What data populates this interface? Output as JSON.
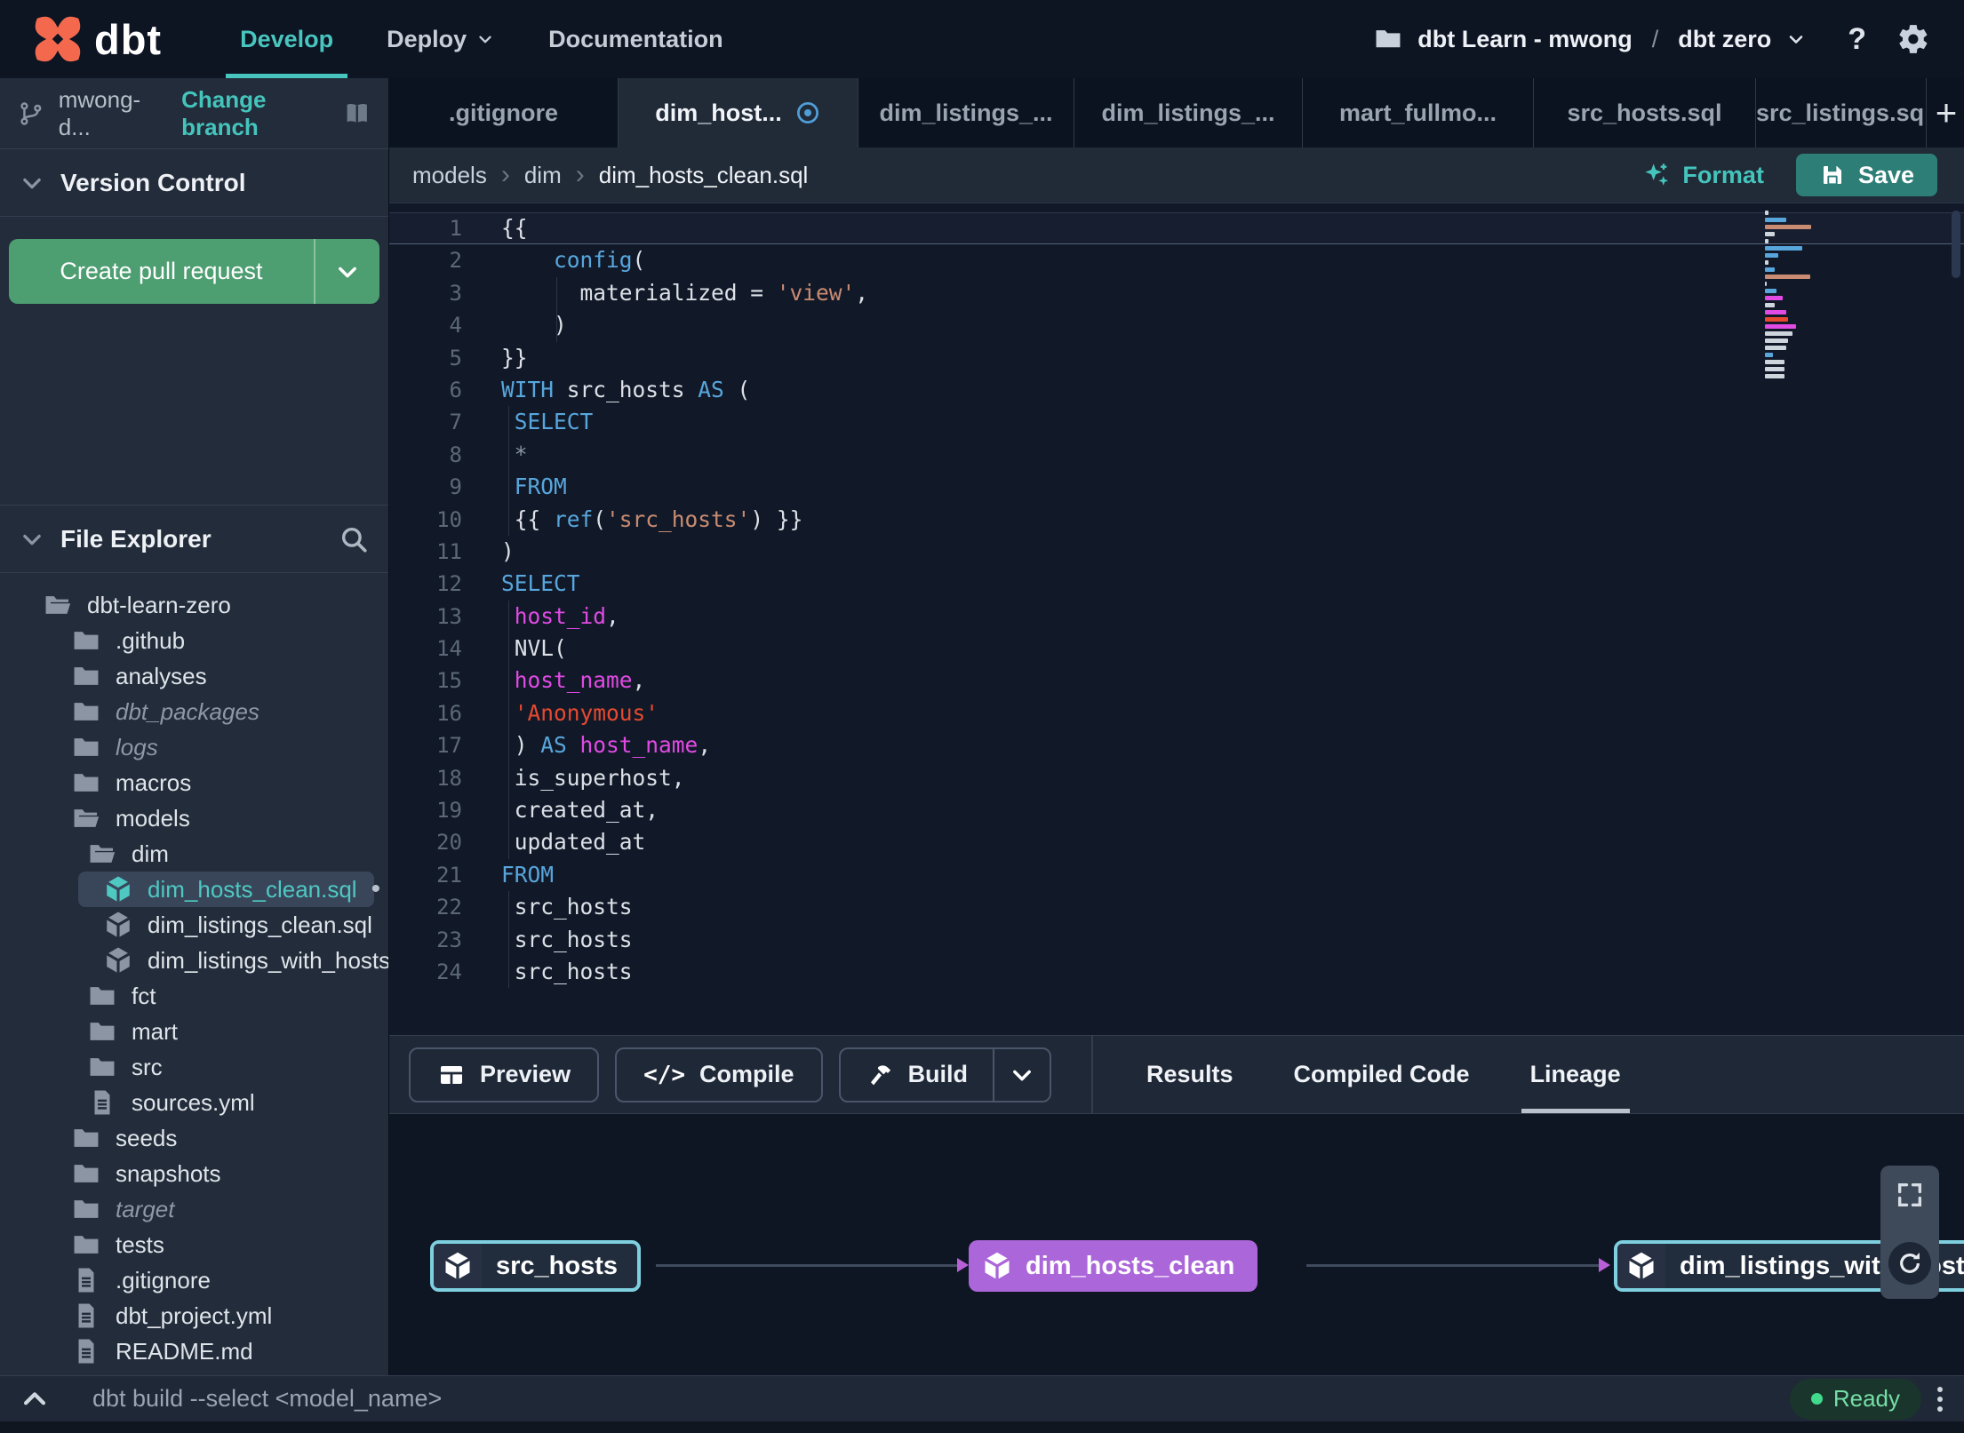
{
  "topnav": {
    "logo_text": "dbt",
    "nav": [
      {
        "label": "Develop",
        "active": true
      },
      {
        "label": "Deploy",
        "caret": true
      },
      {
        "label": "Documentation"
      }
    ],
    "project": {
      "name": "dbt Learn - mwong",
      "sep": "/",
      "env": "dbt zero"
    },
    "help_label": "?"
  },
  "sidebar": {
    "branch": {
      "name": "mwong-d...",
      "change_label": "Change branch"
    },
    "version_control": {
      "title": "Version Control",
      "create_pr_label": "Create pull request"
    },
    "file_explorer": {
      "title": "File Explorer",
      "tree": [
        {
          "label": "dbt-learn-zero",
          "type": "folder-open",
          "level": 0
        },
        {
          "label": ".github",
          "type": "folder",
          "level": 1
        },
        {
          "label": "analyses",
          "type": "folder",
          "level": 1
        },
        {
          "label": "dbt_packages",
          "type": "folder",
          "level": 1,
          "italic": true
        },
        {
          "label": "logs",
          "type": "folder",
          "level": 1,
          "italic": true
        },
        {
          "label": "macros",
          "type": "folder",
          "level": 1
        },
        {
          "label": "models",
          "type": "folder-open",
          "level": 1
        },
        {
          "label": "dim",
          "type": "folder-open",
          "level": 2
        },
        {
          "label": "dim_hosts_clean.sql",
          "type": "model",
          "level": 3,
          "selected": true,
          "modified": true
        },
        {
          "label": "dim_listings_clean.sql",
          "type": "model",
          "level": 3
        },
        {
          "label": "dim_listings_with_hosts...",
          "type": "model",
          "level": 3
        },
        {
          "label": "fct",
          "type": "folder",
          "level": 2
        },
        {
          "label": "mart",
          "type": "folder",
          "level": 2
        },
        {
          "label": "src",
          "type": "folder",
          "level": 2
        },
        {
          "label": "sources.yml",
          "type": "file",
          "level": 2
        },
        {
          "label": "seeds",
          "type": "folder",
          "level": 1
        },
        {
          "label": "snapshots",
          "type": "folder",
          "level": 1
        },
        {
          "label": "target",
          "type": "folder",
          "level": 1,
          "italic": true
        },
        {
          "label": "tests",
          "type": "folder",
          "level": 1
        },
        {
          "label": ".gitignore",
          "type": "file",
          "level": 1
        },
        {
          "label": "dbt_project.yml",
          "type": "file",
          "level": 1
        },
        {
          "label": "README.md",
          "type": "file",
          "level": 1
        }
      ]
    }
  },
  "tabs": [
    {
      "label": ".gitignore"
    },
    {
      "label": "dim_host...",
      "active": true,
      "modified": true
    },
    {
      "label": "dim_listings_..."
    },
    {
      "label": "dim_listings_..."
    },
    {
      "label": "mart_fullmo..."
    },
    {
      "label": "src_hosts.sql"
    },
    {
      "label": "src_listings.sql"
    }
  ],
  "new_tab_label": "+",
  "breadcrumb": {
    "items": [
      "models",
      "dim",
      "dim_hosts_clean.sql"
    ],
    "format_label": "Format",
    "save_label": "Save"
  },
  "editor": {
    "lines": [
      {
        "n": 1,
        "active": true,
        "segs": [
          {
            "t": "{{"
          }
        ]
      },
      {
        "n": 2,
        "segs": [
          {
            "t": "    "
          },
          {
            "t": "config",
            "c": "kw"
          },
          {
            "t": "("
          }
        ]
      },
      {
        "n": 3,
        "guides": [
          62
        ],
        "segs": [
          {
            "t": "      materialized = "
          },
          {
            "t": "'view'",
            "c": "str"
          },
          {
            "t": ","
          }
        ]
      },
      {
        "n": 4,
        "guides": [
          62
        ],
        "segs": [
          {
            "t": "    )"
          }
        ]
      },
      {
        "n": 5,
        "segs": [
          {
            "t": "}}"
          }
        ]
      },
      {
        "n": 6,
        "segs": [
          {
            "t": "WITH",
            "c": "kw"
          },
          {
            "t": " src_hosts "
          },
          {
            "t": "AS",
            "c": "kw"
          },
          {
            "t": " ("
          }
        ]
      },
      {
        "n": 7,
        "guides": [
          8
        ],
        "segs": [
          {
            "t": " "
          },
          {
            "t": "SELECT",
            "c": "kw"
          }
        ]
      },
      {
        "n": 8,
        "guides": [
          8
        ],
        "segs": [
          {
            "t": " "
          },
          {
            "t": "*",
            "c": "dim"
          }
        ]
      },
      {
        "n": 9,
        "guides": [
          8
        ],
        "segs": [
          {
            "t": " "
          },
          {
            "t": "FROM",
            "c": "kw"
          }
        ]
      },
      {
        "n": 10,
        "guides": [
          8
        ],
        "segs": [
          {
            "t": " {{ "
          },
          {
            "t": "ref",
            "c": "kw"
          },
          {
            "t": "("
          },
          {
            "t": "'src_hosts'",
            "c": "str"
          },
          {
            "t": ") }}"
          }
        ]
      },
      {
        "n": 11,
        "segs": [
          {
            "t": ")"
          }
        ]
      },
      {
        "n": 12,
        "segs": [
          {
            "t": "SELECT",
            "c": "kw"
          }
        ]
      },
      {
        "n": 13,
        "guides": [
          8
        ],
        "segs": [
          {
            "t": " "
          },
          {
            "t": "host_id",
            "c": "ident"
          },
          {
            "t": ","
          }
        ]
      },
      {
        "n": 14,
        "guides": [
          8
        ],
        "segs": [
          {
            "t": " NVL("
          }
        ]
      },
      {
        "n": 15,
        "guides": [
          8
        ],
        "segs": [
          {
            "t": " "
          },
          {
            "t": "host_name",
            "c": "ident"
          },
          {
            "t": ","
          }
        ]
      },
      {
        "n": 16,
        "guides": [
          8
        ],
        "segs": [
          {
            "t": " "
          },
          {
            "t": "'Anonymous'",
            "c": "red"
          }
        ]
      },
      {
        "n": 17,
        "guides": [
          8
        ],
        "segs": [
          {
            "t": " ) "
          },
          {
            "t": "AS",
            "c": "kw"
          },
          {
            "t": " "
          },
          {
            "t": "host_name",
            "c": "ident"
          },
          {
            "t": ","
          }
        ]
      },
      {
        "n": 18,
        "guides": [
          8
        ],
        "segs": [
          {
            "t": " is_superhost,"
          }
        ]
      },
      {
        "n": 19,
        "guides": [
          8
        ],
        "segs": [
          {
            "t": " created_at,"
          }
        ]
      },
      {
        "n": 20,
        "guides": [
          8
        ],
        "segs": [
          {
            "t": " updated_at"
          }
        ]
      },
      {
        "n": 21,
        "segs": [
          {
            "t": "FROM",
            "c": "kw"
          }
        ]
      },
      {
        "n": 22,
        "guides": [
          8
        ],
        "segs": [
          {
            "t": " src_hosts"
          }
        ]
      },
      {
        "n": 23,
        "guides": [
          8
        ],
        "segs": [
          {
            "t": " src_hosts"
          }
        ]
      },
      {
        "n": 24,
        "guides": [
          8
        ],
        "segs": [
          {
            "t": " src_hosts"
          }
        ]
      }
    ]
  },
  "bottom_toolbar": {
    "preview_label": "Preview",
    "compile_label": "Compile",
    "compile_icon": "</>",
    "build_label": "Build"
  },
  "result_tabs": [
    {
      "label": "Results"
    },
    {
      "label": "Compiled Code"
    },
    {
      "label": "Lineage",
      "active": true
    }
  ],
  "lineage": {
    "nodes": [
      {
        "label": "src_hosts",
        "style": "cyan"
      },
      {
        "label": "dim_hosts_clean",
        "style": "purple"
      },
      {
        "label": "dim_listings_with_hosts",
        "style": "cyan"
      }
    ]
  },
  "statusbar": {
    "command": "dbt build --select <model_name>",
    "status": "Ready"
  },
  "colors": {
    "accent_teal": "#45c4bc",
    "green_button": "#4d9e71",
    "save_teal": "#2e7e78",
    "node_cyan": "#7ed0e0",
    "node_purple": "#ab66d9",
    "edge_arrow_purple": "#b95fd8",
    "modified_blue": "#4f9ed8",
    "status_green": "#41d98c",
    "keyword_blue": "#58a6dc",
    "string_orange": "#c98b71",
    "error_red": "#e6492f",
    "identifier_magenta": "#e14ae3",
    "logo_orange": "#f4694e"
  }
}
